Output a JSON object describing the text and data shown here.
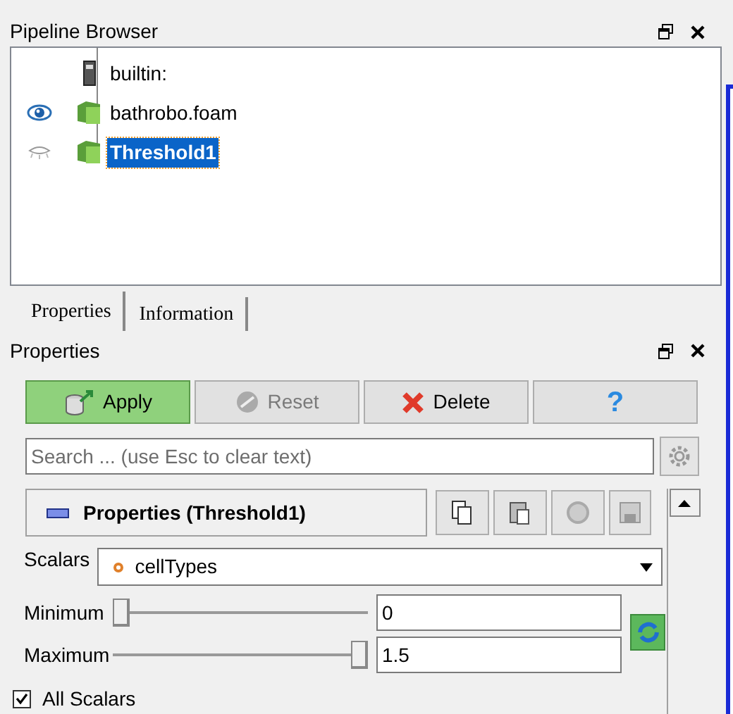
{
  "pipeline_browser": {
    "title": "Pipeline Browser",
    "items": [
      {
        "label": "builtin:",
        "kind": "server",
        "selected": false,
        "children": [
          {
            "label": "bathrobo.foam",
            "kind": "source",
            "visible": true,
            "selected": false,
            "children": [
              {
                "label": "Threshold1",
                "kind": "source",
                "visible": false,
                "selected": true
              }
            ]
          }
        ]
      }
    ]
  },
  "tabs": [
    {
      "label": "Properties",
      "selected": true
    },
    {
      "label": "Information",
      "selected": false
    }
  ],
  "properties": {
    "title": "Properties",
    "buttons": [
      {
        "label": "Apply",
        "kind": "apply",
        "disabled": false
      },
      {
        "label": "Reset",
        "kind": "reset",
        "disabled": true
      },
      {
        "label": "Delete",
        "kind": "delete",
        "disabled": false
      },
      {
        "label": "?",
        "kind": "help",
        "disabled": false
      }
    ],
    "search": {
      "placeholder": "Search ... (use Esc to clear text)"
    },
    "section": "Properties (Threshold1)",
    "scalars": {
      "label": "Scalars",
      "value": "cellTypes"
    },
    "sliders": [
      {
        "label": "Minimum",
        "level": 0.0,
        "value": "0"
      },
      {
        "label": "Maximum",
        "level": 1.0,
        "value": "1.5"
      }
    ],
    "all_scalars": {
      "label": "All Scalars",
      "checked": true
    }
  }
}
